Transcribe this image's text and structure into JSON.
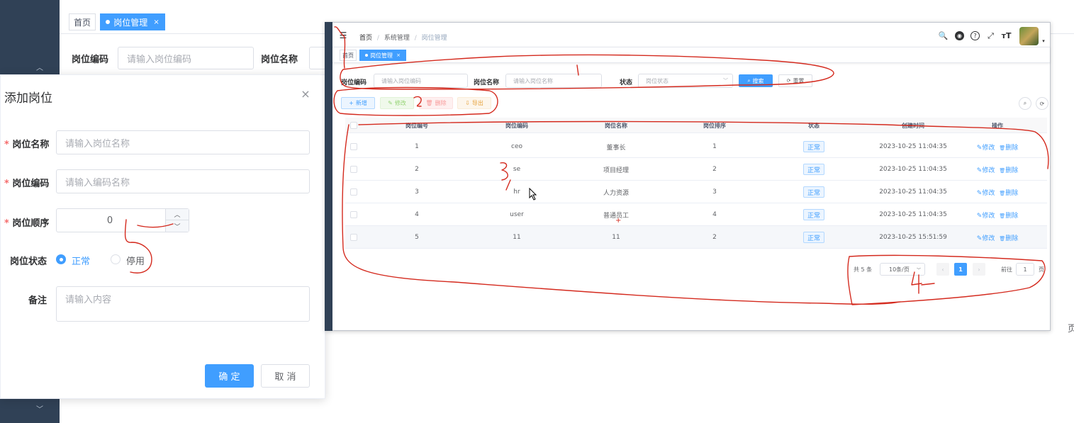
{
  "background": {
    "tabs": [
      {
        "label": "首页"
      },
      {
        "label": "岗位管理"
      }
    ],
    "search": {
      "code_label": "岗位编码",
      "code_placeholder": "请输入岗位编码",
      "name_label": "岗位名称",
      "name_placeholder": "请输入岗位名称"
    },
    "pagination_fragment": "页"
  },
  "dialog": {
    "title": "添加岗位",
    "fields": {
      "name_label": "岗位名称",
      "name_placeholder": "请输入岗位名称",
      "code_label": "岗位编码",
      "code_placeholder": "请输入编码名称",
      "order_label": "岗位顺序",
      "order_value": "0",
      "status_label": "岗位状态",
      "status_options": [
        "正常",
        "停用"
      ],
      "remark_label": "备注",
      "remark_placeholder": "请输入内容"
    },
    "confirm": "确 定",
    "cancel": "取 消"
  },
  "app": {
    "breadcrumb": [
      "首页",
      "系统管理",
      "岗位管理"
    ],
    "tabs": [
      {
        "label": "首页"
      },
      {
        "label": "岗位管理"
      }
    ],
    "search": {
      "code_label": "岗位编码",
      "code_placeholder": "请输入岗位编码",
      "name_label": "岗位名称",
      "name_placeholder": "请输入岗位名称",
      "status_label": "状态",
      "status_placeholder": "岗位状态",
      "search_btn": "搜索",
      "reset_btn": "重置"
    },
    "toolbar": {
      "add": "新增",
      "edit": "修改",
      "delete": "删除",
      "export": "导出"
    },
    "table": {
      "columns": [
        "岗位编号",
        "岗位编码",
        "岗位名称",
        "岗位排序",
        "状态",
        "创建时间",
        "操作"
      ],
      "rows": [
        {
          "id": "1",
          "code": "ceo",
          "name": "董事长",
          "sort": "1",
          "status": "正常",
          "created": "2023-10-25 11:04:35"
        },
        {
          "id": "2",
          "code": "se",
          "name": "项目经理",
          "sort": "2",
          "status": "正常",
          "created": "2023-10-25 11:04:35"
        },
        {
          "id": "3",
          "code": "hr",
          "name": "人力资源",
          "sort": "3",
          "status": "正常",
          "created": "2023-10-25 11:04:35"
        },
        {
          "id": "4",
          "code": "user",
          "name": "普通员工",
          "sort": "4",
          "status": "正常",
          "created": "2023-10-25 11:04:35"
        },
        {
          "id": "5",
          "code": "11",
          "name": "11",
          "sort": "2",
          "status": "正常",
          "created": "2023-10-25 15:51:59"
        }
      ],
      "action_edit": "修改",
      "action_delete": "删除"
    },
    "pagination": {
      "total": "共 5 条",
      "page_size": "10条/页",
      "current": "1",
      "goto_label": "前往",
      "goto_value": "1",
      "page_suffix": "页"
    }
  },
  "annotations": [
    "1",
    "2",
    "3",
    "4",
    "5"
  ],
  "colors": {
    "primary": "#409eff",
    "sidebar": "#304156",
    "annotation": "#d42a1e",
    "success": "#67c23a",
    "danger": "#f56c6c",
    "warning": "#e6a23c"
  }
}
